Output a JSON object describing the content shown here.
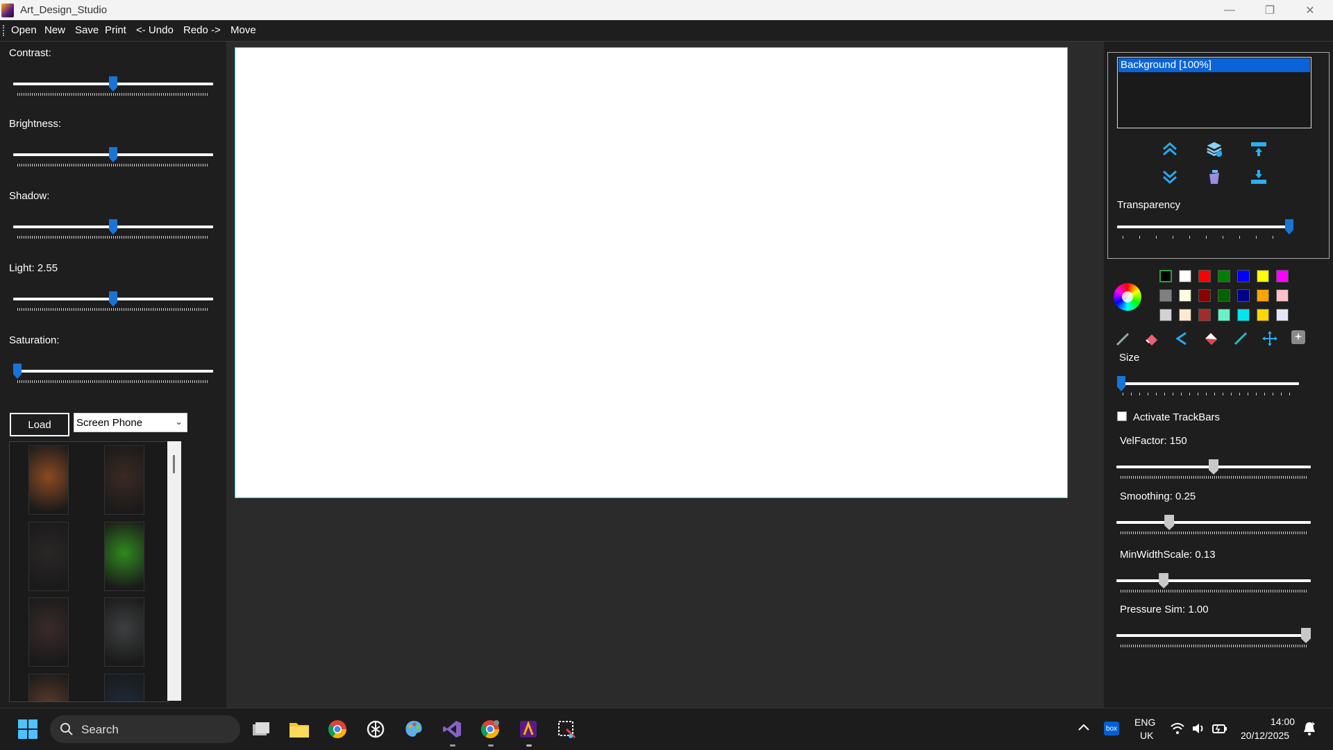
{
  "window": {
    "title": "Art_Design_Studio",
    "minimize": "—",
    "maximize": "❐",
    "close": "✕"
  },
  "menu": {
    "items": [
      "Open",
      "New",
      "Save",
      "Print",
      "<- Undo",
      "Redo ->",
      "Move"
    ]
  },
  "left": {
    "adjustments": [
      {
        "label": "Contrast:",
        "value_fraction": 0.5
      },
      {
        "label": "Brightness:",
        "value_fraction": 0.5
      },
      {
        "label": "Shadow:",
        "value_fraction": 0.5
      },
      {
        "label": "Light: 2.55",
        "value_fraction": 0.5
      },
      {
        "label": "Saturation:",
        "value_fraction": 0.0
      }
    ],
    "load_label": "Load",
    "combo_value": "Screen Phone",
    "gallery_colors": [
      [
        "#8a4b22",
        "#3a2a22"
      ],
      [
        "#2a2626",
        "#2f8a1e"
      ],
      [
        "#3a2a2a",
        "#3d3f40"
      ],
      [
        "#5a3a2a",
        "#1e2a3a"
      ]
    ]
  },
  "right": {
    "layer_item": "Background [100%]",
    "transparency_label": "Transparency",
    "transparency_fraction": 1.0,
    "colors": [
      [
        "#000000",
        "#ffffff",
        "#ff0000",
        "#008000",
        "#0000ff",
        "#ffff00",
        "#ff00ff"
      ],
      [
        "#808080",
        "#fffde0",
        "#8b0000",
        "#006400",
        "#00008b",
        "#ffa500",
        "#ffc0cb"
      ],
      [
        "#d3d3d3",
        "#fde9d0",
        "#a52a2a",
        "#66f2c8",
        "#00e5ee",
        "#ffd700",
        "#e6e6fa"
      ]
    ],
    "size_label": "Size",
    "size_fraction": 0.0,
    "activate_label": "Activate TrackBars",
    "trackbars": [
      {
        "label": "VelFactor: 150",
        "value_fraction": 0.5
      },
      {
        "label": "Smoothing: 0.25",
        "value_fraction": 0.26
      },
      {
        "label": "MinWidthScale: 0.13",
        "value_fraction": 0.23
      },
      {
        "label": "Pressure Sim: 1.00",
        "value_fraction": 1.0
      }
    ]
  },
  "taskbar": {
    "search": "Search",
    "lang1": "ENG",
    "lang2": "UK",
    "time": "14:00",
    "date": "20/12/2025",
    "tray_box": "box"
  }
}
